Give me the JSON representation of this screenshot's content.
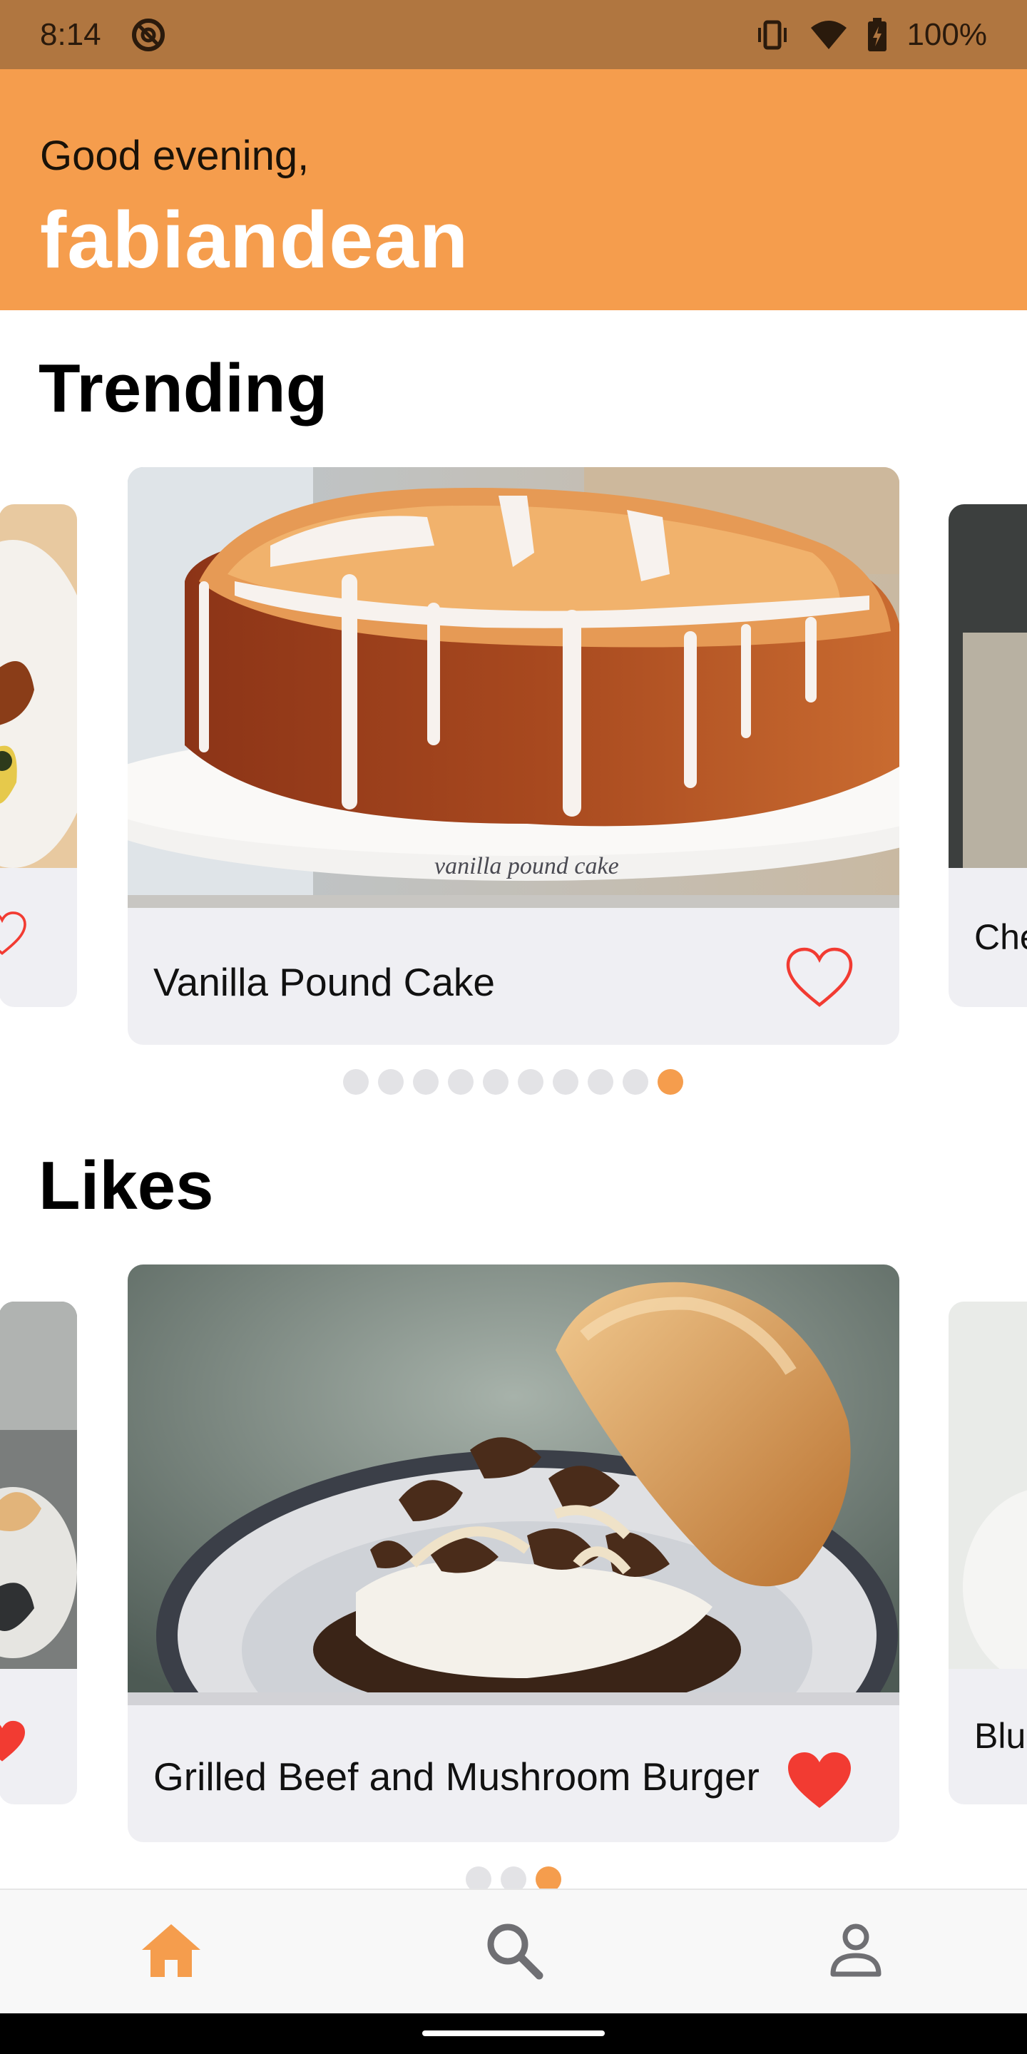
{
  "status_bar": {
    "time": "8:14",
    "battery": "100%"
  },
  "header": {
    "greeting": "Good evening,",
    "username": "fabiandean"
  },
  "trending": {
    "title": "Trending",
    "main_card": {
      "title": "Vanilla Pound Cake",
      "liked": false,
      "image_text": "vanilla pound cake"
    },
    "right_peek_title": "Che",
    "dots_total": 10,
    "dots_active_index": 9
  },
  "likes": {
    "title": "Likes",
    "main_card": {
      "title": "Grilled Beef and Mushroom Burger",
      "liked": true
    },
    "right_peek_title": "Blu",
    "dots_total": 3,
    "dots_active_index": 2
  },
  "bottom_nav": {
    "items": [
      {
        "name": "home-icon",
        "active": true
      },
      {
        "name": "search-icon",
        "active": false
      },
      {
        "name": "profile-icon",
        "active": false
      }
    ]
  },
  "colors": {
    "accent": "#f59d4d",
    "status_bar": "#b07640",
    "heart_red": "#f23b32",
    "card_bg": "#efeff3"
  }
}
